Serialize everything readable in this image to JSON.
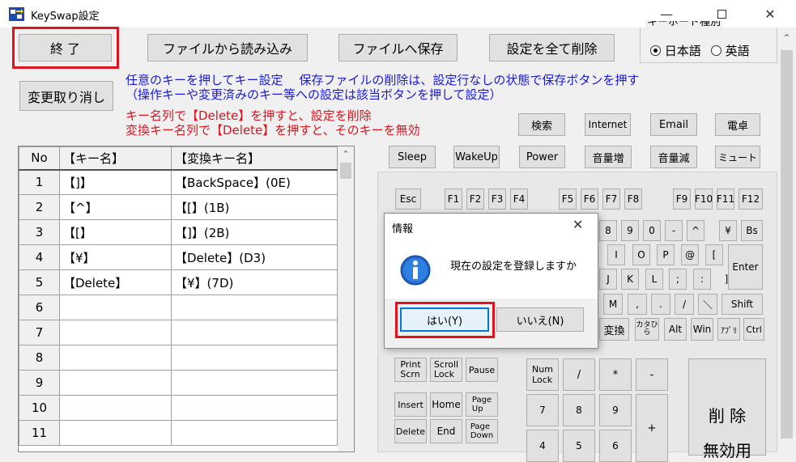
{
  "window": {
    "title": "KeySwap設定"
  },
  "toolbar": {
    "exit": "終 了",
    "load": "ファイルから読み込み",
    "save": "ファイルへ保存",
    "delete_all": "設定を全て削除",
    "undo": "変更取り消し"
  },
  "keyboard_type": {
    "label": "キーボード種別",
    "options": [
      {
        "label": "日本語",
        "selected": true
      },
      {
        "label": "英語",
        "selected": false
      }
    ]
  },
  "info": {
    "line1": "任意のキーを押してキー設定　 保存ファイルの削除は、設定行なしの状態で保存ボタンを押す",
    "line2": "（操作キーや変更済みのキー等への設定は該当ボタンを押して設定）",
    "line3": "キー名列で【Delete】を押すと、設定を削除",
    "line4": "変換キー名列で【Delete】を押すと、そのキーを無効"
  },
  "table": {
    "headers": [
      "No",
      "【キー名】",
      "【変換キー名】"
    ],
    "rows": [
      [
        "1",
        "【]】",
        "【BackSpace】(0E)"
      ],
      [
        "2",
        "【^】",
        "【[】(1B)"
      ],
      [
        "3",
        "【[】",
        "【]】(2B)"
      ],
      [
        "4",
        "【¥】",
        "【Delete】(D3)"
      ],
      [
        "5",
        "【Delete】",
        "【¥】(7D)"
      ],
      [
        "6",
        "",
        ""
      ],
      [
        "7",
        "",
        ""
      ],
      [
        "8",
        "",
        ""
      ],
      [
        "9",
        "",
        ""
      ],
      [
        "10",
        "",
        ""
      ],
      [
        "11",
        "",
        ""
      ]
    ]
  },
  "special_keys": {
    "row1": [
      "検索",
      "Internet",
      "Email",
      "電卓"
    ],
    "row2": [
      "Sleep",
      "WakeUp",
      "Power",
      "音量増",
      "音量減",
      "ミュート"
    ]
  },
  "keys": {
    "esc": "Esc",
    "f1_4": [
      "F1",
      "F2",
      "F3",
      "F4"
    ],
    "f5_8": [
      "F5",
      "F6",
      "F7",
      "F8"
    ],
    "f9_12": [
      "F9",
      "F10",
      "F11",
      "F12"
    ],
    "num_row": [
      "8",
      "9",
      "0",
      "-",
      "^",
      "¥",
      "Bs"
    ],
    "q_row": [
      "I",
      "O",
      "P",
      "@",
      "[",
      "Enter"
    ],
    "a_row": [
      "J",
      "K",
      "L",
      ";",
      ":",
      "]"
    ],
    "z_row": [
      "M",
      ",",
      ".",
      "/",
      "＼",
      "Shift"
    ],
    "space_row": [
      "変換",
      "カタひら",
      "Alt",
      "Win",
      "ｱﾌﾟﾘ",
      "Ctrl"
    ],
    "nav": {
      "print": "Print\nScrn",
      "scroll": "Scroll\nLock",
      "pause": "Pause",
      "insert": "Insert",
      "home": "Home",
      "pageup": "Page\nUp",
      "delete": "Delete",
      "end": "End",
      "pagedown": "Page\nDown"
    },
    "numpad": {
      "numlock": "Num\nLock",
      "div": "/",
      "mul": "*",
      "minus": "-",
      "n7": "7",
      "n8": "8",
      "n9": "9",
      "plus": "+",
      "n4": "4",
      "n5": "5",
      "n6": "6"
    },
    "delete_big": "削 除",
    "disable_big": "無効用"
  },
  "dialog": {
    "title": "情報",
    "message": "現在の設定を登録しますか",
    "yes": "はい(Y)",
    "no": "いいえ(N)"
  },
  "colors": {
    "highlight": "#e0141e",
    "info_blue": "#1a1ad8"
  }
}
